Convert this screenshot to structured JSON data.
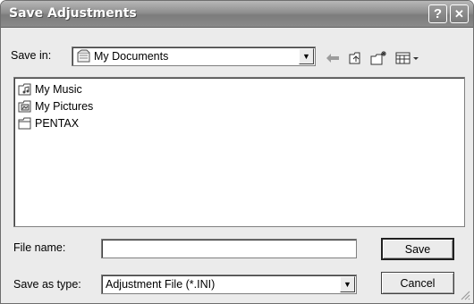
{
  "window": {
    "title": "Save Adjustments",
    "help_glyph": "?",
    "close_glyph": "✕"
  },
  "savein": {
    "label": "Save in:",
    "value": "My Documents"
  },
  "toolbar": {
    "icons": [
      "back-icon",
      "up-folder-icon",
      "new-folder-icon",
      "view-menu-icon"
    ]
  },
  "files": [
    {
      "name": "My Music",
      "icon": "music-folder-icon"
    },
    {
      "name": "My Pictures",
      "icon": "pictures-folder-icon"
    },
    {
      "name": "PENTAX",
      "icon": "folder-icon"
    }
  ],
  "filename": {
    "label": "File name:",
    "value": ""
  },
  "savetype": {
    "label": "Save as type:",
    "value": "Adjustment File (*.INI)"
  },
  "buttons": {
    "save": "Save",
    "cancel": "Cancel"
  }
}
